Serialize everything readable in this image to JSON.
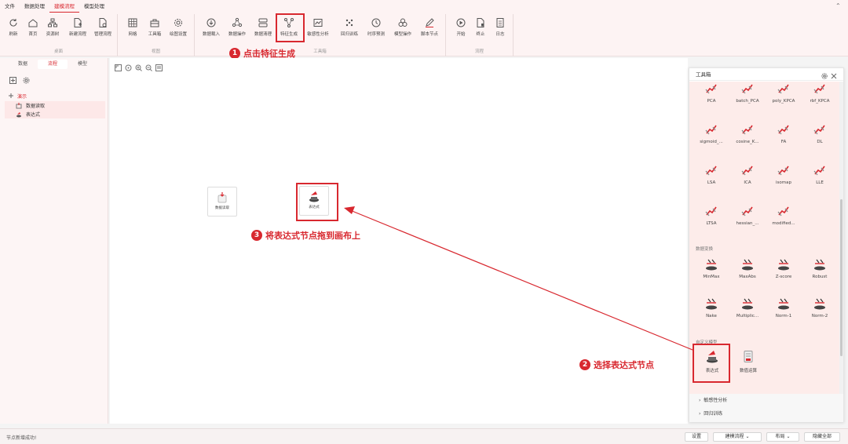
{
  "menu": [
    "文件",
    "数据处理",
    "建模流程",
    "模型处理"
  ],
  "menu_active": 2,
  "ribbon": {
    "groups": [
      {
        "title": "桌面",
        "buttons": [
          "刷新",
          "首页",
          "资源树",
          "新建流程",
          "管理流程"
        ]
      },
      {
        "title": "视图",
        "buttons": [
          "网格",
          "工具箱",
          "绘图设置"
        ]
      },
      {
        "title": "工具箱",
        "buttons": [
          "数据载入",
          "数据操作",
          "数据清理",
          "特征生成",
          "敏感性分析",
          "回归训练",
          "时序预测",
          "模型操作",
          "脚本节点"
        ]
      },
      {
        "title": "流程",
        "buttons": [
          "开始",
          "终止",
          "日志"
        ]
      }
    ]
  },
  "left_panel": {
    "tabs": [
      "数据",
      "流程",
      "模型"
    ],
    "active_tab": 1,
    "tree_root": "演示",
    "tree_items": [
      "数据读取",
      "表达式"
    ]
  },
  "canvas": {
    "nodes": [
      "数据读取",
      "表达式"
    ]
  },
  "callouts": [
    {
      "num": "1",
      "text": "点击特征生成"
    },
    {
      "num": "2",
      "text": "选择表达式节点"
    },
    {
      "num": "3",
      "text": "将表达式节点拖到画布上"
    }
  ],
  "toolbox": {
    "title": "工具箱",
    "rows": [
      [
        "PCA",
        "batch_PCA",
        "poly_KPCA",
        "rbf_KPCA"
      ],
      [
        "sigmoid_...",
        "cosine_K...",
        "FA",
        "DL"
      ],
      [
        "LSA",
        "ICA",
        "isomap",
        "LLE"
      ],
      [
        "LTSA",
        "hessian_...",
        "modified..."
      ]
    ],
    "section_transform": "数据变换",
    "transform_rows": [
      [
        "MinMax",
        "MaxAbs",
        "Z-score",
        "Robust"
      ],
      [
        "Nake",
        "Multiplic...",
        "Norm-1",
        "Norm-2"
      ]
    ],
    "section_custom": "自定义模型",
    "custom_items": [
      "表达式",
      "数值运算"
    ],
    "collapsed_groups": [
      "敏感性分析",
      "回归训练"
    ]
  },
  "status": {
    "message": "节点新增成功!",
    "buttons": [
      "设置",
      "建模流程",
      "布局",
      "隐藏全部"
    ]
  },
  "colors": {
    "accent": "#d8282f",
    "panel_bg": "#fdecea"
  }
}
